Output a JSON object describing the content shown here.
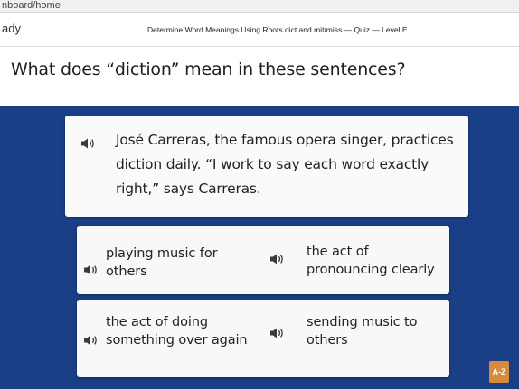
{
  "browser": {
    "url": "nboard/home"
  },
  "header": {
    "left_text": "ady",
    "quiz_title": "Determine Word Meanings Using Roots dict and mit/miss — Quiz — Level E"
  },
  "question": {
    "text": "What does “diction” mean in these sentences?"
  },
  "passage": {
    "before": "José Carreras, the famous opera singer, practices ",
    "highlight": "diction",
    "after": " daily. “I work to say each word exactly right,” says Carreras."
  },
  "choices": [
    {
      "label": "playing music for others"
    },
    {
      "label": "the act of pronouncing clearly"
    },
    {
      "label": "the act of doing something over again"
    },
    {
      "label": "sending music to others"
    }
  ],
  "icons": {
    "speaker": "speaker-icon",
    "az": "az-level-icon"
  },
  "badge": {
    "az_label": "A-Z"
  },
  "colors": {
    "background": "#1b3f86",
    "card": "#fafafa",
    "badge": "#d88a3c"
  }
}
